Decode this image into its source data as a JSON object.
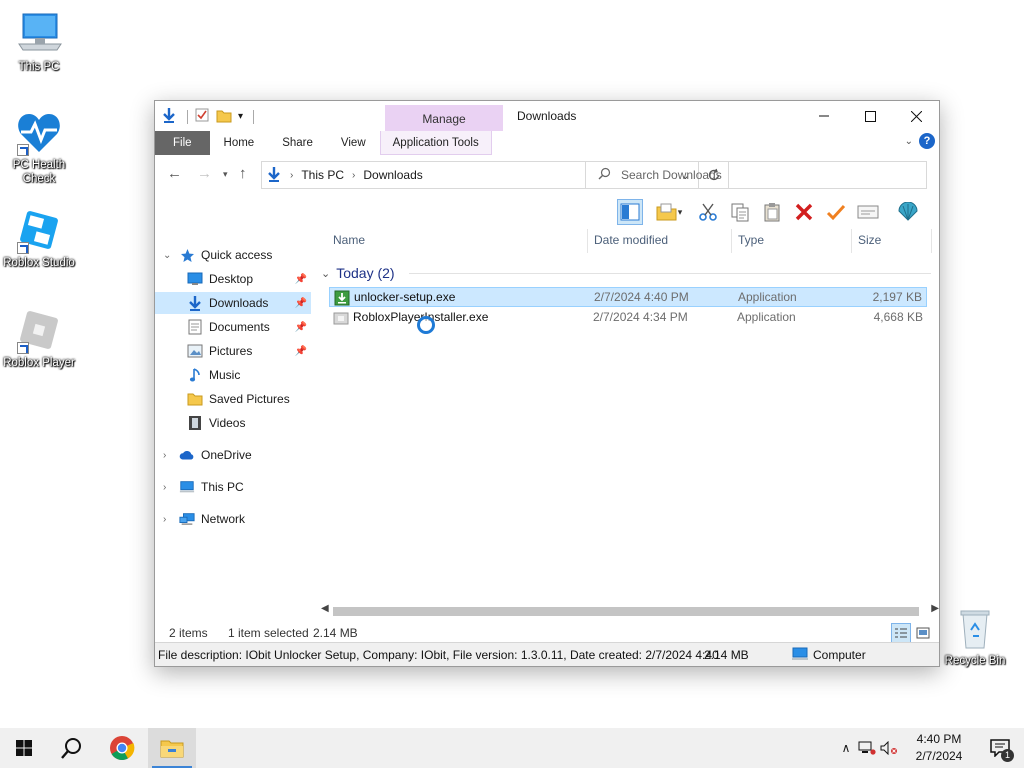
{
  "desktop": {
    "icons": [
      {
        "label": "This PC"
      },
      {
        "label": "PC Health Check"
      },
      {
        "label": "Roblox Studio"
      },
      {
        "label": "Roblox Player"
      },
      {
        "label": "Recycle Bin"
      }
    ]
  },
  "window": {
    "title": "Downloads",
    "context_tab_group": "Manage",
    "ribbon_tabs": [
      "File",
      "Home",
      "Share",
      "View",
      "Application Tools"
    ],
    "address": {
      "segments": [
        "This PC",
        "Downloads"
      ]
    },
    "search": {
      "placeholder": "Search Downloads"
    },
    "nav": {
      "quick_access": "Quick access",
      "items": [
        {
          "label": "Desktop",
          "pinned": true
        },
        {
          "label": "Downloads",
          "pinned": true,
          "selected": true
        },
        {
          "label": "Documents",
          "pinned": true
        },
        {
          "label": "Pictures",
          "pinned": true
        },
        {
          "label": "Music",
          "pinned": false
        },
        {
          "label": "Saved Pictures",
          "pinned": false
        },
        {
          "label": "Videos",
          "pinned": false
        }
      ],
      "onedrive": "OneDrive",
      "this_pc": "This PC",
      "network": "Network"
    },
    "columns": {
      "name": "Name",
      "date": "Date modified",
      "type": "Type",
      "size": "Size"
    },
    "group": {
      "label": "Today (2)"
    },
    "files": [
      {
        "name": "unlocker-setup.exe",
        "date": "2/7/2024 4:40 PM",
        "type": "Application",
        "size": "2,197 KB",
        "selected": true
      },
      {
        "name": "RobloxPlayerInstaller.exe",
        "date": "2/7/2024 4:34 PM",
        "type": "Application",
        "size": "4,668 KB",
        "selected": false
      }
    ],
    "status": {
      "items": "2 items",
      "selected": "1 item selected",
      "size": "2.14 MB"
    },
    "infobar": {
      "description": "File description: IObit Unlocker Setup, Company: IObit, File version: 1.3.0.11, Date created: 2/7/2024 4:40",
      "size": "2.14 MB",
      "location": "Computer"
    }
  },
  "taskbar": {
    "time": "4:40 PM",
    "date": "2/7/2024",
    "notification_count": "1"
  },
  "colors": {
    "selection": "#cce8ff",
    "selection_border": "#99d1ff",
    "accent": "#1c66c9",
    "manage_tab": "#ead2f3"
  }
}
